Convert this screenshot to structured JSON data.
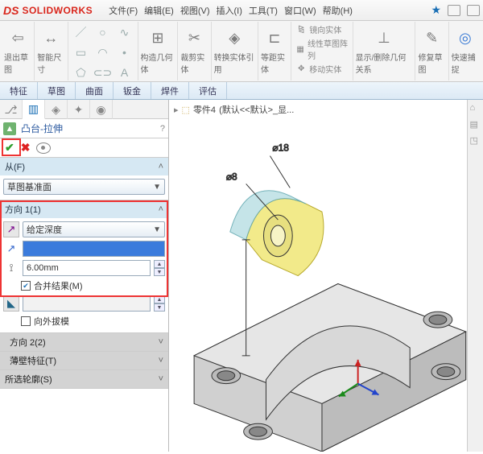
{
  "title": {
    "brand": "SOLIDWORKS"
  },
  "menu": [
    "文件(F)",
    "编辑(E)",
    "视图(V)",
    "插入(I)",
    "工具(T)",
    "窗口(W)",
    "帮助(H)"
  ],
  "ribbon": {
    "exit_sketch": "退出草图",
    "smart_dim": "智能尺寸",
    "g1": "构造几何体",
    "g2": "裁剪实体",
    "g3": "转换实体引用",
    "g4": "等距实体",
    "g_mirror": "镜向实体",
    "g_linear": "线性草图阵列",
    "g_move": "移动实体",
    "g_disp": "显示/删除几何关系",
    "g_repair": "修复草图",
    "g_snap": "快速捕捉"
  },
  "tabs": [
    "特征",
    "草图",
    "曲面",
    "钣金",
    "焊件",
    "评估"
  ],
  "fm": {
    "feature_name": "凸台-拉伸",
    "from_label": "从(F)",
    "from_value": "草图基准面",
    "dir1_label": "方向 1(1)",
    "dir1_type": "给定深度",
    "dir1_depth": "6.00mm",
    "dir1_blank": "",
    "dir1_merge": "合并结果(M)",
    "draft_out": "向外拔模",
    "dir2_label": "方向 2(2)",
    "thin_label": "薄壁特征(T)",
    "sel_label": "所选轮廓(S)"
  },
  "crumb": {
    "prefix": "零件4",
    "suffix": " (默认<<默认>_显..."
  },
  "dims": {
    "d1": "⌀18",
    "d2": "⌀8",
    "d3": ""
  }
}
